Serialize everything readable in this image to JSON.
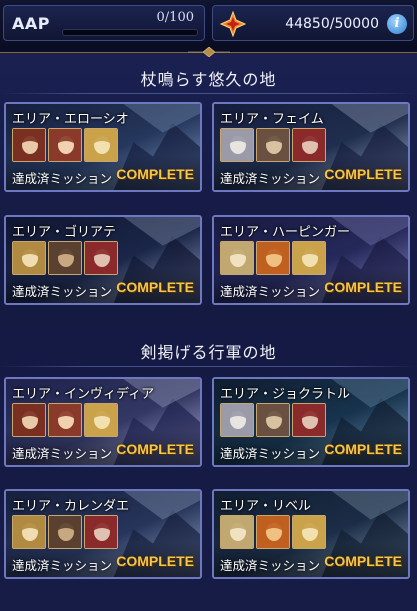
{
  "header": {
    "aap_label": "AAP",
    "aap_count": "0/100",
    "aap_progress": 0,
    "resource_icon": "star-crystal-icon",
    "resource_value": "44850/50000",
    "info_icon": "info-icon"
  },
  "sections": [
    {
      "title": "杖鳴らす悠久の地",
      "cards": [
        {
          "title": "エリア・エローシオ",
          "mission_label": "達成済ミッション",
          "status": "COMPLETE"
        },
        {
          "title": "エリア・フェイム",
          "mission_label": "達成済ミッション",
          "status": "COMPLETE"
        },
        {
          "title": "エリア・ゴリアテ",
          "mission_label": "達成済ミッション",
          "status": "COMPLETE"
        },
        {
          "title": "エリア・ハーピンガー",
          "mission_label": "達成済ミッション",
          "status": "COMPLETE"
        }
      ]
    },
    {
      "title": "剣掲げる行軍の地",
      "cards": [
        {
          "title": "エリア・インヴィディア",
          "mission_label": "達成済ミッション",
          "status": "COMPLETE"
        },
        {
          "title": "エリア・ジョクラトル",
          "mission_label": "達成済ミッション",
          "status": "COMPLETE"
        },
        {
          "title": "エリア・カレンダエ",
          "mission_label": "達成済ミッション",
          "status": "COMPLETE"
        },
        {
          "title": "エリア・リベル",
          "mission_label": "達成済ミッション",
          "status": "COMPLETE"
        }
      ]
    }
  ],
  "colors": {
    "complete": "#f4c64a",
    "card_border": "#6e78c0",
    "panel_bg": "#161c46"
  }
}
